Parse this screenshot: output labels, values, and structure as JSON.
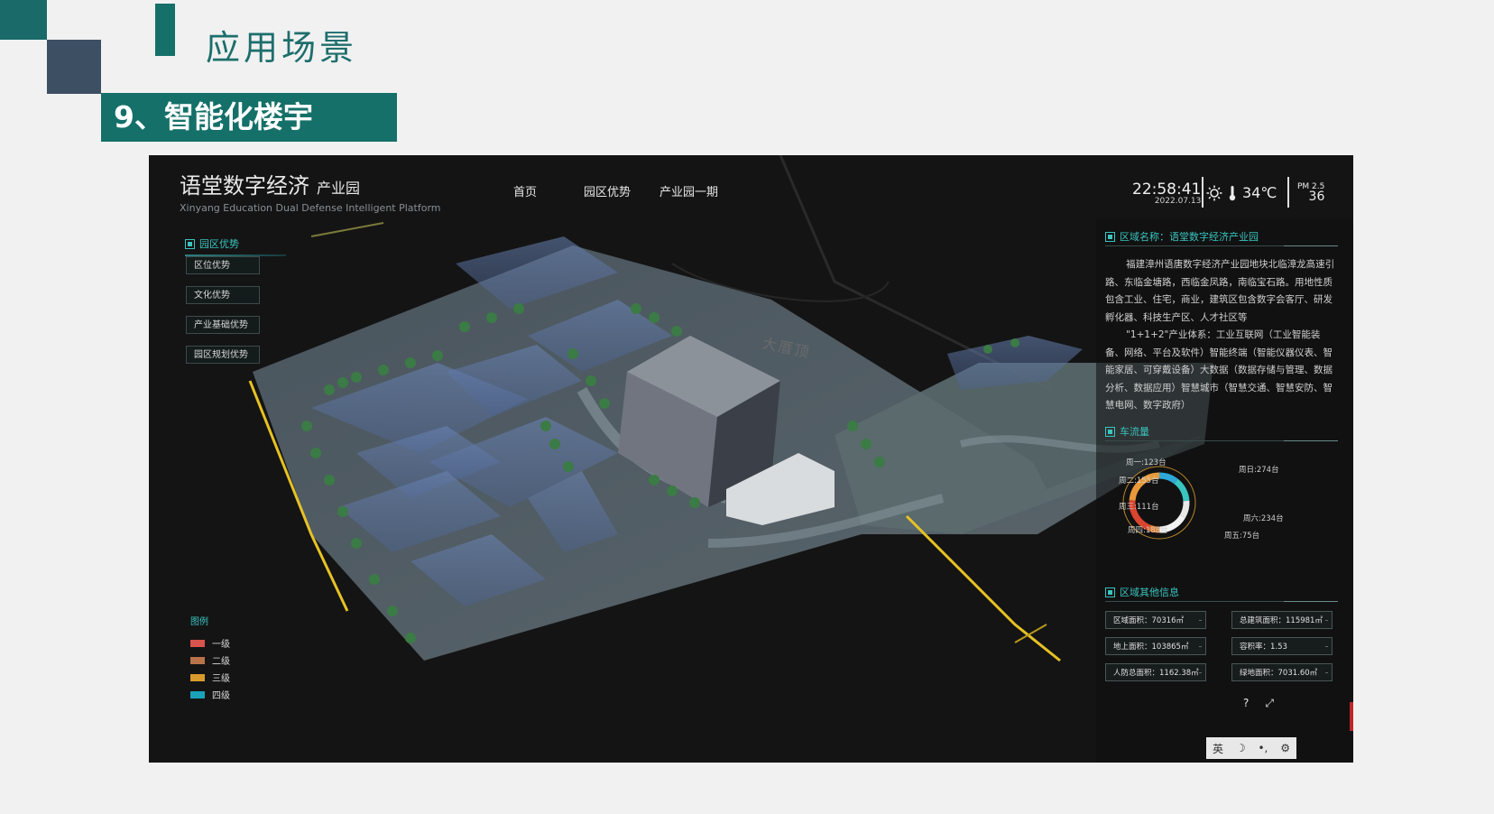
{
  "slide": {
    "title": "应用场景",
    "section": "9、智能化楼宇"
  },
  "brand": {
    "title": "语堂数字经济",
    "subtitle": "产业园",
    "english": "Xinyang Education Dual Defense Intelligent Platform"
  },
  "nav": {
    "items": [
      {
        "label": "首页"
      },
      {
        "label": "园区优势"
      },
      {
        "label": "产业园一期"
      }
    ]
  },
  "status": {
    "time": "22:58:41",
    "date": "2022.07.13",
    "weather_icon": "sun-icon",
    "temperature": "34℃",
    "pm_label": "PM 2.5",
    "pm_value": "36"
  },
  "left_panel": {
    "title": "园区优势",
    "buttons": [
      {
        "label": "区位优势"
      },
      {
        "label": "文化优势"
      },
      {
        "label": "产业基础优势"
      },
      {
        "label": "园区规划优势"
      }
    ]
  },
  "map": {
    "label": "大厝顶"
  },
  "legend": {
    "title": "图例",
    "items": [
      {
        "label": "一级",
        "color": "#d9534f"
      },
      {
        "label": "二级",
        "color": "#b8734a"
      },
      {
        "label": "三级",
        "color": "#d99a2b"
      },
      {
        "label": "四级",
        "color": "#1aa3b8"
      }
    ]
  },
  "region": {
    "title": "区域名称：语堂数字经济产业园",
    "paragraphs": [
      "福建漳州语唐数字经济产业园地块北临漳龙高速引路、东临金塘路，西临金凤路，南临宝石路。用地性质包含工业、住宅，商业，建筑区包含数字会客厅、研发孵化器、科技生产区、人才社区等",
      "\"1+1+2\"产业体系：工业互联网（工业智能装备、网络、平台及软件）智能终端（智能仪器仪表、智能家居、可穿戴设备）大数据（数据存储与管理、数据分析、数据应用）智慧城市（智慧交通、智慧安防、智慧电网、数字政府）"
    ]
  },
  "traffic": {
    "title": "车流量",
    "labels": [
      "周一:123台",
      "周二:155台",
      "周三:111台",
      "周四:188台",
      "周五:75台",
      "周六:234台",
      "周日:274台"
    ]
  },
  "other_info": {
    "title": "区域其他信息",
    "stats": [
      {
        "label": "区域面积：70316㎡"
      },
      {
        "label": "总建筑面积：115981㎡"
      },
      {
        "label": "地上面积：103865㎡"
      },
      {
        "label": "容积率：1.53"
      },
      {
        "label": "人防总面积：1162.38㎡"
      },
      {
        "label": "绿地面积：7031.60㎡"
      }
    ]
  },
  "tools": {
    "help": "?",
    "expand": "⤢",
    "ime": [
      "英",
      "☽",
      "•,",
      "⚙"
    ]
  },
  "chart_data": {
    "type": "pie",
    "title": "车流量",
    "categories": [
      "周一",
      "周二",
      "周三",
      "周四",
      "周五",
      "周六",
      "周日"
    ],
    "values": [
      123,
      155,
      111,
      188,
      75,
      234,
      274
    ],
    "unit": "台"
  }
}
